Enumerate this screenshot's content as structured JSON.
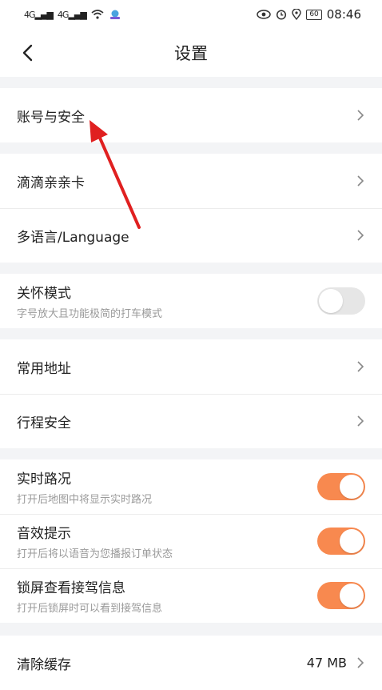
{
  "status_bar": {
    "sig1": "4G",
    "sig2": "4G",
    "battery": "60",
    "time": "08:46",
    "icons": [
      "signal-icon",
      "wifi-icon",
      "app-icon",
      "eye-icon",
      "alarm-icon",
      "location-icon",
      "battery-icon"
    ]
  },
  "header": {
    "title": "设置",
    "back_icon": "chevron-left-icon"
  },
  "groups": {
    "account": {
      "label": "账号与安全"
    },
    "card": {
      "label": "滴滴亲亲卡"
    },
    "language": {
      "label": "多语言/Language"
    },
    "care": {
      "label": "关怀模式",
      "sub": "字号放大且功能极简的打车模式",
      "on": false
    },
    "address": {
      "label": "常用地址"
    },
    "trip_safety": {
      "label": "行程安全"
    },
    "traffic": {
      "label": "实时路况",
      "sub": "打开后地图中将显示实时路况",
      "on": true
    },
    "sound": {
      "label": "音效提示",
      "sub": "打开后将以语音为您播报订单状态",
      "on": true
    },
    "lockscreen": {
      "label": "锁屏查看接驾信息",
      "sub": "打开后锁屏时可以看到接驾信息",
      "on": true
    },
    "cache": {
      "label": "清除缓存",
      "value": "47 MB"
    }
  },
  "colors": {
    "accent": "#f8894f",
    "annotation_arrow": "#e02020"
  }
}
